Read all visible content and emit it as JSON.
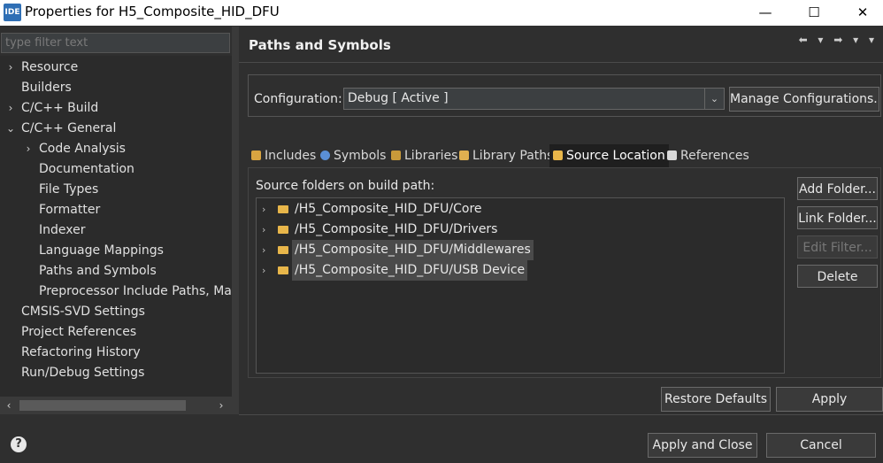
{
  "window": {
    "icon_label": "IDE",
    "title": "Properties for H5_Composite_HID_DFU",
    "minimize": "—",
    "maximize": "☐",
    "close": "✕"
  },
  "sidebar": {
    "filter_placeholder": "type filter text",
    "items": [
      {
        "label": "Resource",
        "arrow": "›"
      },
      {
        "label": "Builders",
        "arrow": ""
      },
      {
        "label": "C/C++ Build",
        "arrow": "›"
      },
      {
        "label": "C/C++ General",
        "arrow": "⌄"
      },
      {
        "label": "Code Analysis",
        "arrow": "›"
      },
      {
        "label": "Documentation",
        "arrow": ""
      },
      {
        "label": "File Types",
        "arrow": ""
      },
      {
        "label": "Formatter",
        "arrow": ""
      },
      {
        "label": "Indexer",
        "arrow": ""
      },
      {
        "label": "Language Mappings",
        "arrow": ""
      },
      {
        "label": "Paths and Symbols",
        "arrow": ""
      },
      {
        "label": "Preprocessor Include Paths, Macro",
        "arrow": ""
      },
      {
        "label": "CMSIS-SVD Settings",
        "arrow": ""
      },
      {
        "label": "Project References",
        "arrow": ""
      },
      {
        "label": "Refactoring History",
        "arrow": ""
      },
      {
        "label": "Run/Debug Settings",
        "arrow": ""
      }
    ],
    "scroll_left": "‹",
    "scroll_right": "›"
  },
  "main": {
    "page_title": "Paths and Symbols",
    "nav": "⬅ ▾ ➡ ▾ ▾",
    "config_label": "Configuration:",
    "config_value": "Debug  [ Active ]",
    "config_dropdown": "⌄",
    "manage_configs": "Manage Configurations...",
    "tabs": [
      {
        "label": "Includes",
        "color": "#d9a441"
      },
      {
        "label": "Symbols",
        "color": "#5a8fd6"
      },
      {
        "label": "Libraries",
        "color": "#c99a3a"
      },
      {
        "label": "Library Paths",
        "color": "#e0b050"
      },
      {
        "label": "Source Location",
        "color": "#e8b64a"
      },
      {
        "label": "References",
        "color": "#d8d8d8"
      }
    ],
    "source_label": "Source folders on build path:",
    "source_folders": [
      {
        "path": "/H5_Composite_HID_DFU/Core"
      },
      {
        "path": "/H5_Composite_HID_DFU/Drivers"
      },
      {
        "path": "/H5_Composite_HID_DFU/Middlewares"
      },
      {
        "path": "/H5_Composite_HID_DFU/USB Device"
      }
    ],
    "expander": "›",
    "buttons": {
      "add_folder": "Add Folder...",
      "link_folder": "Link Folder...",
      "edit_filter": "Edit Filter...",
      "delete": "Delete"
    },
    "restore_defaults": "Restore Defaults",
    "apply": "Apply"
  },
  "footer": {
    "help": "?",
    "apply_and_close": "Apply and Close",
    "cancel": "Cancel"
  }
}
